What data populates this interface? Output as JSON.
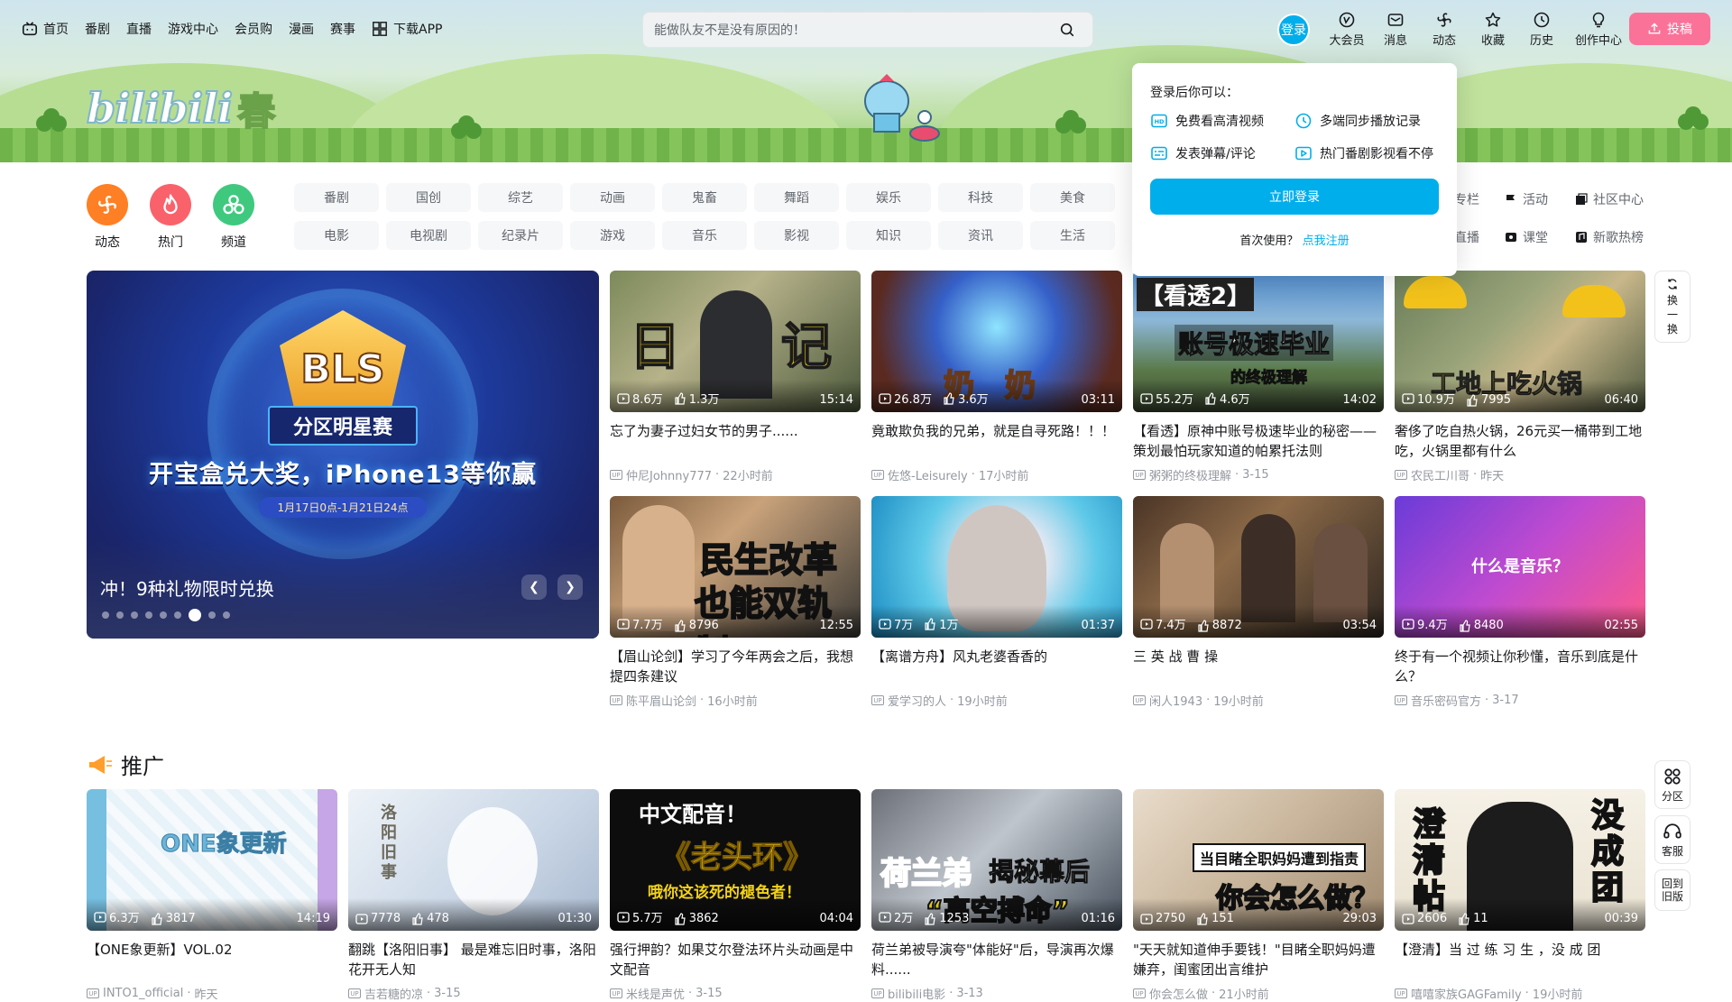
{
  "nav": {
    "left": [
      {
        "label": "首页",
        "icon": "tv-icon"
      },
      {
        "label": "番剧"
      },
      {
        "label": "直播"
      },
      {
        "label": "游戏中心"
      },
      {
        "label": "会员购"
      },
      {
        "label": "漫画"
      },
      {
        "label": "赛事"
      },
      {
        "label": "下载APP",
        "icon": "grid-icon"
      }
    ],
    "search_placeholder": "能做队友不是没有原因的！",
    "login_label": "登录",
    "right": [
      {
        "label": "大会员",
        "icon": "vip-icon"
      },
      {
        "label": "消息",
        "icon": "mail-icon"
      },
      {
        "label": "动态",
        "icon": "fan-icon"
      },
      {
        "label": "收藏",
        "icon": "star-icon"
      },
      {
        "label": "历史",
        "icon": "clock-icon"
      },
      {
        "label": "创作中心",
        "icon": "bulb-icon"
      }
    ],
    "post_label": "投稿"
  },
  "brand": {
    "logo_text": "bilibili",
    "logo_suffix": "春"
  },
  "quick": [
    {
      "label": "动态",
      "color": "#ff7f24"
    },
    {
      "label": "热门",
      "color": "#f9626b"
    },
    {
      "label": "频道",
      "color": "#3fc97e"
    }
  ],
  "channels": {
    "row1": [
      "番剧",
      "国创",
      "综艺",
      "动画",
      "鬼畜",
      "舞蹈",
      "娱乐",
      "科技",
      "美食"
    ],
    "row2": [
      "电影",
      "电视剧",
      "纪录片",
      "游戏",
      "音乐",
      "影视",
      "知识",
      "资讯",
      "生活"
    ],
    "extras_row1": [
      "专栏",
      "活动",
      "社区中心"
    ],
    "extras_row2": [
      "直播",
      "课堂",
      "新歌热榜"
    ]
  },
  "carousel": {
    "emblem": "BLS",
    "ribbon": "分区明星赛",
    "headline": "开宝盒兑大奖，iPhone13等你赢",
    "date": "1月17日0点-1月21日24点",
    "caption": "冲！9种礼物限时兑换",
    "dot_count": 9,
    "active_dot": 6
  },
  "videos": [
    {
      "views": "8.6万",
      "likes": "1.3万",
      "duration": "15:14",
      "title": "忘了为妻子过妇女节的男子......",
      "author": "仲尼Johnny777",
      "time": "22小时前",
      "overlay": "日　　记"
    },
    {
      "views": "26.8万",
      "likes": "3.6万",
      "duration": "03:11",
      "title": "竟敢欺负我的兄弟，就是自寻死路！！！",
      "author": "佐悠-Leisurely",
      "time": "17小时前",
      "overlay": "奶　奶"
    },
    {
      "views": "55.2万",
      "likes": "4.6万",
      "duration": "14:02",
      "title": "【看透】原神中账号极速毕业的秘密——策划最怕玩家知道的帕累托法则",
      "author": "粥粥的终极理解",
      "time": "3-15",
      "overlay": "账号极速毕业",
      "overlay2": "【看透2】",
      "overlay3": "的终极理解"
    },
    {
      "views": "10.9万",
      "likes": "7995",
      "duration": "06:40",
      "title": "奢侈了吃自热火锅，26元买一桶带到工地吃，火锅里都有什么",
      "author": "农民工川哥",
      "time": "昨天",
      "overlay": "工地上吃火锅"
    },
    {
      "views": "7.7万",
      "likes": "8796",
      "duration": "12:55",
      "title": "【眉山论剑】学习了今年两会之后，我想提四条建议",
      "author": "陈平眉山论剑",
      "time": "16小时前",
      "overlay": "民生改革",
      "overlay2": "也能双轨制"
    },
    {
      "views": "7万",
      "likes": "1万",
      "duration": "01:37",
      "title": "【离谱方舟】风丸老婆香香的",
      "author": "爱学习的人",
      "time": "19小时前"
    },
    {
      "views": "7.4万",
      "likes": "8872",
      "duration": "03:54",
      "title": "三 英 战 曹 操",
      "author": "闲人1943",
      "time": "19小时前"
    },
    {
      "views": "9.4万",
      "likes": "8480",
      "duration": "02:55",
      "title": "终于有一个视频让你秒懂，音乐到底是什么？",
      "author": "音乐密码官方",
      "time": "3-17",
      "overlay": "什么是音乐？"
    }
  ],
  "popover": {
    "title": "登录后你可以：",
    "features": [
      "免费看高清视频",
      "多端同步播放记录",
      "发表弹幕/评论",
      "热门番剧影视看不停"
    ],
    "login_btn": "立即登录",
    "first_use": "首次使用？",
    "register": "点我注册"
  },
  "side": {
    "refresh": "换一换",
    "sections": "分区",
    "service": "客服",
    "old": "回到旧版"
  },
  "promo": {
    "title": "推广",
    "items": [
      {
        "views": "6.3万",
        "likes": "3817",
        "duration": "14:19",
        "title": "【ONE象更新】VOL.02",
        "overlay": "ONE象更新",
        "author": "INTO1_official",
        "time": "昨天"
      },
      {
        "views": "7778",
        "likes": "478",
        "duration": "01:30",
        "title": "翻跳【洛阳旧事】 最是难忘旧时事，洛阳花开无人知",
        "overlay": "洛阳旧事",
        "author": "吉若糖的凉",
        "time": "3-15"
      },
      {
        "views": "5.7万",
        "likes": "3862",
        "duration": "04:04",
        "title": "强行押韵？如果艾尔登法环片头动画是中文配音",
        "overlay": "中文配音！",
        "overlay2": "《老头环》",
        "overlay3": "哦你这该死的褪色者！",
        "author": "米线是声优",
        "time": "3-15"
      },
      {
        "views": "2万",
        "likes": "1253",
        "duration": "01:16",
        "title": "荷兰弟被导演夸\"体能好\"后，导演再次爆料......",
        "overlay": "荷兰弟",
        "overlay2": "揭秘幕后",
        "overlay3": "“高空搏命”",
        "author": "bilibili电影",
        "time": "3-13"
      },
      {
        "views": "2750",
        "likes": "151",
        "duration": "29:03",
        "title": "\"天天就知道伸手要钱！\"目睹全职妈妈遭嫌弃，闺蜜团出言维护",
        "overlay": "当目睹全职妈妈遭到指责",
        "overlay2": "你会怎么做？",
        "author": "你会怎么做",
        "time": "21小时前"
      },
      {
        "views": "2606",
        "likes": "11",
        "duration": "00:39",
        "title": "【澄清】当 过 练 习 生 ，没 成 团",
        "overlay": "澄清帖",
        "overlay2": "没成团",
        "author": "嘻嘻家族GAGFamily",
        "time": "19小时前"
      }
    ]
  }
}
